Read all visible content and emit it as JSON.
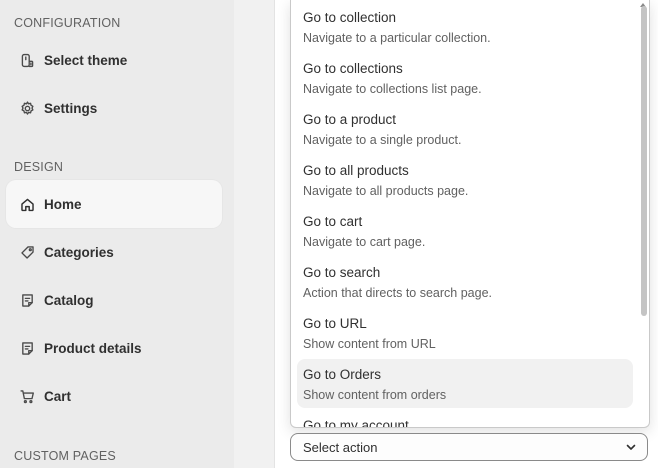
{
  "sidebar": {
    "configuration_label": "CONFIGURATION",
    "design_label": "DESIGN",
    "custom_pages_label": "CUSTOM PAGES",
    "items": [
      {
        "label": "Select theme",
        "icon": "theme-icon"
      },
      {
        "label": "Settings",
        "icon": "gear-icon"
      },
      {
        "label": "Home",
        "icon": "home-icon",
        "active": true
      },
      {
        "label": "Categories",
        "icon": "tag-icon"
      },
      {
        "label": "Catalog",
        "icon": "page-icon"
      },
      {
        "label": "Product details",
        "icon": "page-icon"
      },
      {
        "label": "Cart",
        "icon": "cart-icon"
      }
    ]
  },
  "dropdown": {
    "options": [
      {
        "title": "Go to collection",
        "desc": "Navigate to a particular collection."
      },
      {
        "title": "Go to collections",
        "desc": "Navigate to collections list page."
      },
      {
        "title": "Go to a product",
        "desc": "Navigate to a single product."
      },
      {
        "title": "Go to all products",
        "desc": "Navigate to all products page."
      },
      {
        "title": "Go to cart",
        "desc": "Navigate to cart page."
      },
      {
        "title": "Go to search",
        "desc": "Action that directs to search page."
      },
      {
        "title": "Go to URL",
        "desc": "Show content from URL"
      },
      {
        "title": "Go to Orders",
        "desc": "Show content from orders"
      },
      {
        "title": "Go to my account",
        "desc": ""
      }
    ],
    "hovered_index": 7
  },
  "select": {
    "value": "Select action"
  },
  "colors": {
    "sidebar_bg": "#ebebeb",
    "active_item_bg": "#f7f7f7",
    "hover_option_bg": "#f1f1f1",
    "text_primary": "#303030",
    "text_secondary": "#616161"
  }
}
